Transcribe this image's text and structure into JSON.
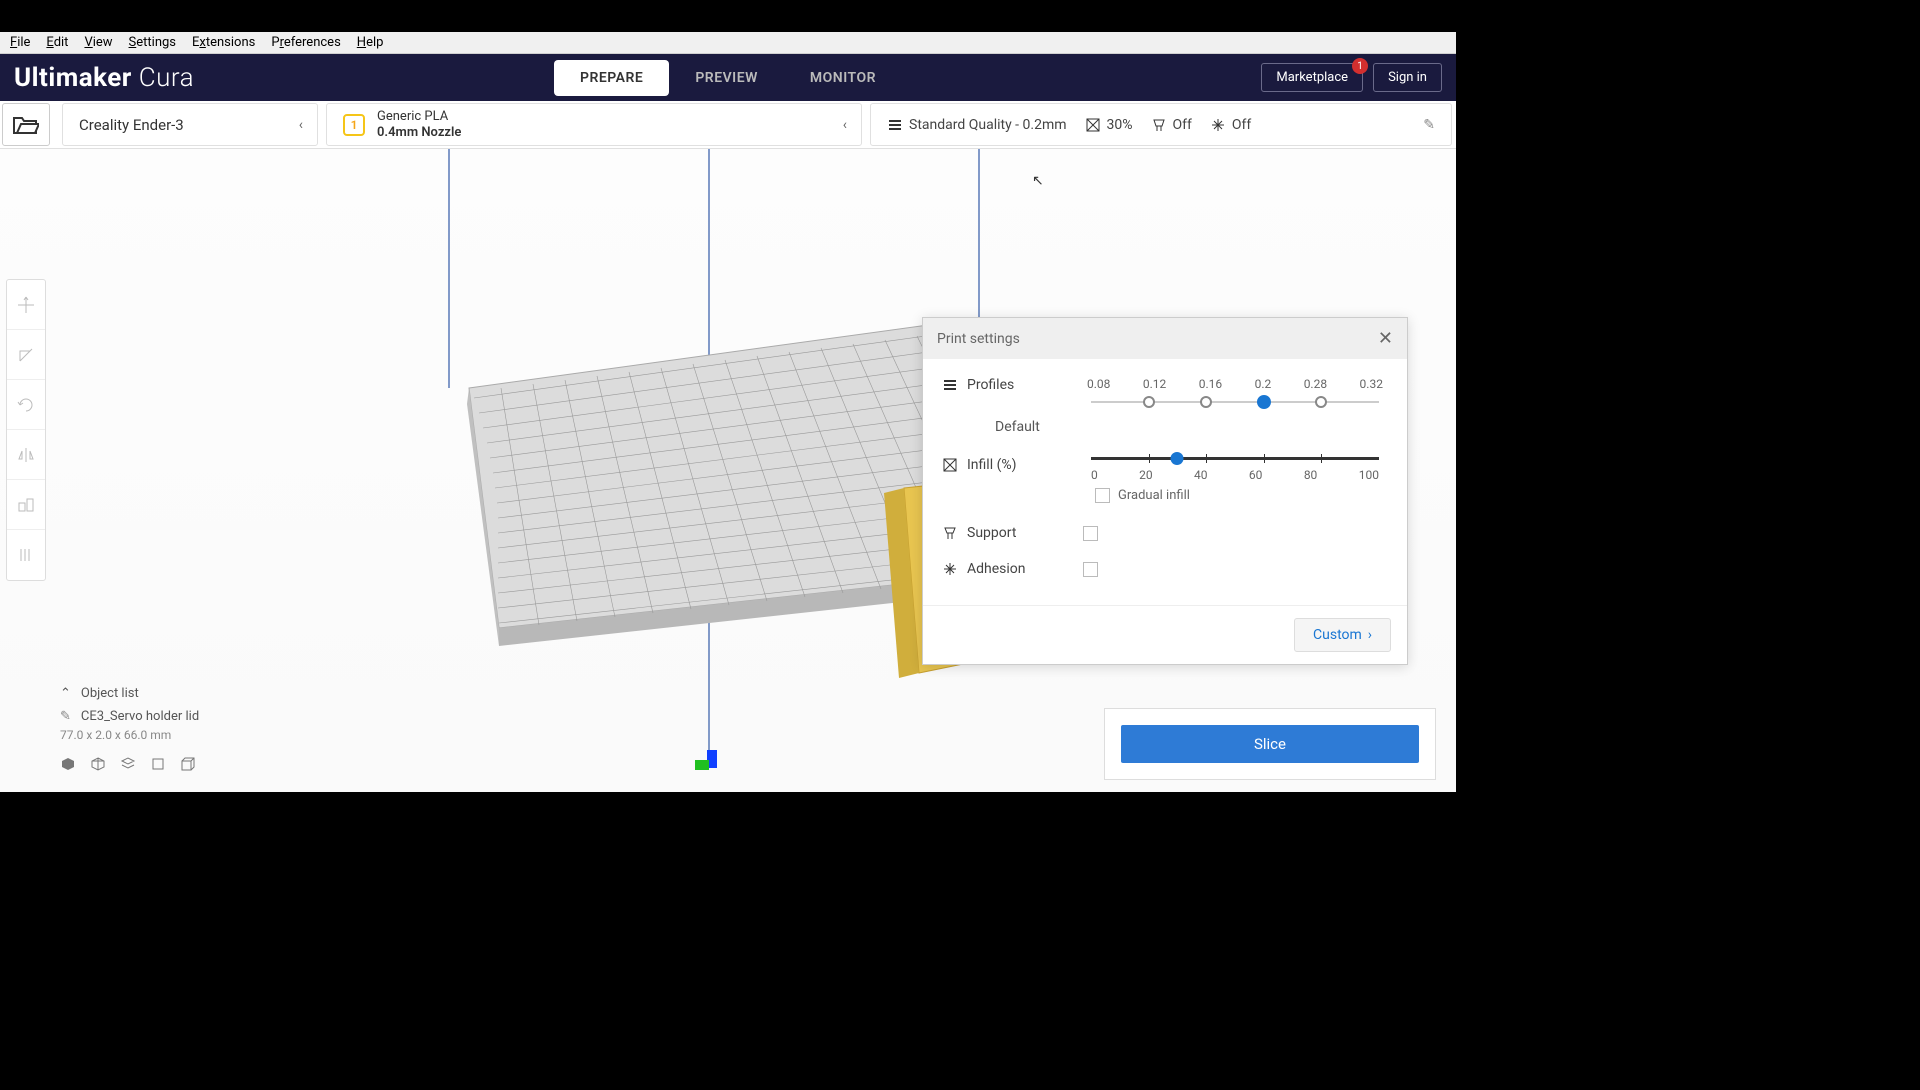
{
  "menubar": [
    "File",
    "Edit",
    "View",
    "Settings",
    "Extensions",
    "Preferences",
    "Help"
  ],
  "logo": {
    "brand": "Ultimaker",
    "product": "Cura"
  },
  "tabs": {
    "prepare": "PREPARE",
    "preview": "PREVIEW",
    "monitor": "MONITOR"
  },
  "header_buttons": {
    "marketplace": "Marketplace",
    "signin": "Sign in",
    "badge": "1"
  },
  "printer": "Creality Ender-3",
  "material": {
    "badge": "1",
    "name": "Generic PLA",
    "nozzle": "0.4mm Nozzle"
  },
  "quality_summary": {
    "profile": "Standard Quality - 0.2mm",
    "infill": "30%",
    "support": "Off",
    "adhesion": "Off"
  },
  "print_settings": {
    "title": "Print settings",
    "profiles_label": "Profiles",
    "default_label": "Default",
    "profile_values": [
      "0.08",
      "0.12",
      "0.16",
      "0.2",
      "0.28",
      "0.32"
    ],
    "infill_label": "Infill (%)",
    "infill_ticks": [
      "0",
      "20",
      "40",
      "60",
      "80",
      "100"
    ],
    "gradual_label": "Gradual infill",
    "support_label": "Support",
    "adhesion_label": "Adhesion",
    "custom_label": "Custom"
  },
  "object_list": {
    "title": "Object list",
    "item_name": "CE3_Servo holder lid",
    "dimensions": "77.0 x 2.0 x 66.0 mm"
  },
  "slice_button": "Slice"
}
